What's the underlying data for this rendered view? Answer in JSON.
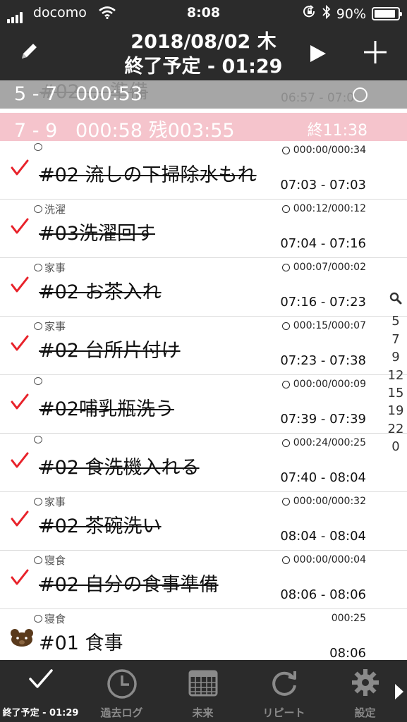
{
  "status_bar": {
    "carrier": "docomo",
    "time": "8:08",
    "battery": "90%",
    "battery_level": 0.9
  },
  "header": {
    "title_line1": "2018/08/02 木",
    "title_line2": "終了予定 - 01:29",
    "icons": [
      "pencil-icon",
      "play-icon",
      "plus-icon"
    ]
  },
  "summaries": {
    "grey": {
      "range": "5 - 7",
      "elapsed": "000:53",
      "ghost_title": "#02 ... 準備",
      "ghost_time": "06:57 - 07:0"
    },
    "pink": {
      "range": "7 - 9",
      "elapsed": "000:58 残003:55",
      "end": "終11:38"
    }
  },
  "tasks": [
    {
      "tag": "",
      "counter": "000:00/000:34",
      "name": "#02 流しの下掃除水もれ",
      "time": "07:03 - 07:03",
      "done": true
    },
    {
      "tag": "洗濯",
      "counter": "000:12/000:12",
      "name": "#03洗濯回す",
      "time": "07:04 - 07:16",
      "done": true
    },
    {
      "tag": "家事",
      "counter": "000:07/000:02",
      "name": "#02 お茶入れ",
      "time": "07:16 - 07:23",
      "done": true
    },
    {
      "tag": "家事",
      "counter": "000:15/000:07",
      "name": "#02 台所片付け",
      "time": "07:23 - 07:38",
      "done": true
    },
    {
      "tag": "",
      "counter": "000:00/000:09",
      "name": "#02哺乳瓶洗う",
      "time": "07:39 - 07:39",
      "done": true
    },
    {
      "tag": "",
      "counter": "000:24/000:25",
      "name": "#02 食洗機入れる",
      "time": "07:40 - 08:04",
      "done": true
    },
    {
      "tag": "家事",
      "counter": "000:00/000:32",
      "name": "#02 茶碗洗い",
      "time": "08:04 - 08:04",
      "done": true
    },
    {
      "tag": "寝食",
      "counter": "000:00/000:04",
      "name": "#02 自分の食事準備",
      "time": "08:06 - 08:06",
      "done": true
    },
    {
      "tag": "寝食",
      "counter": "000:25",
      "name": "#01 食事",
      "time": "08:06",
      "done": false
    }
  ],
  "side_index": [
    "5",
    "7",
    "9",
    "12",
    "15",
    "19",
    "22",
    "0"
  ],
  "tabs": [
    {
      "label": "終了予定 - 01:29",
      "icon": "check-icon",
      "active": true
    },
    {
      "label": "過去ログ",
      "icon": "clock-icon",
      "active": false
    },
    {
      "label": "未来",
      "icon": "calendar-icon",
      "active": false
    },
    {
      "label": "リピート",
      "icon": "repeat-icon",
      "active": false
    },
    {
      "label": "設定",
      "icon": "gear-icon",
      "active": false
    }
  ],
  "colors": {
    "bar": "#2b2b2b",
    "grey_row": "#a6a6a6",
    "pink_row": "#f5c4cc",
    "check": "#e8222a",
    "bear": "#5a3a1c"
  }
}
